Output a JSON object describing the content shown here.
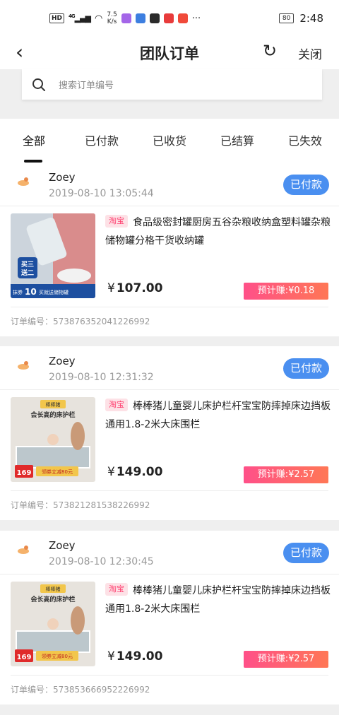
{
  "status_bar": {
    "network": "4G",
    "speed_value": "7.5",
    "speed_unit": "K/s",
    "battery": "80",
    "time": "2:48"
  },
  "nav": {
    "title": "团队订单",
    "close_label": "关闭"
  },
  "search": {
    "placeholder": "搜索订单编号"
  },
  "tabs": [
    {
      "label": "全部"
    },
    {
      "label": "已付款"
    },
    {
      "label": "已收货"
    },
    {
      "label": "已结算"
    },
    {
      "label": "已失效"
    }
  ],
  "orders": [
    {
      "user": "Zoey",
      "time": "2019-08-10 13:05:44",
      "status": "已付款",
      "platform": "淘宝",
      "title": "食品级密封罐厨房五谷杂粮收纳盒塑料罐杂粮储物罐分格干货收纳罐",
      "price": "107.00",
      "estimate": "预计赚:¥0.18",
      "order_no": "订单编号：573876352041226992",
      "thumb": {
        "badge_line1": "买三",
        "badge_line2": "送二",
        "promo": "10",
        "promo_prefix": "抹券",
        "promo_suffix": "买就送储物罐"
      }
    },
    {
      "user": "Zoey",
      "time": "2019-08-10 12:31:32",
      "status": "已付款",
      "platform": "淘宝",
      "title": "棒棒猪儿童婴儿床护栏杆宝宝防摔掉床边挡板通用1.8-2米大床围栏",
      "price": "149.00",
      "estimate": "预计赚:¥2.57",
      "order_no": "订单编号：573821281538226992",
      "thumb": {
        "brand": "棒棒猪",
        "headline": "会长高的床护栏",
        "price_tag": "169",
        "coupon": "领券立减80元"
      }
    },
    {
      "user": "Zoey",
      "time": "2019-08-10 12:30:45",
      "status": "已付款",
      "platform": "淘宝",
      "title": "棒棒猪儿童婴儿床护栏杆宝宝防摔掉床边挡板通用1.8-2米大床围栏",
      "price": "149.00",
      "estimate": "预计赚:¥2.57",
      "order_no": "订单编号：573853666952226992",
      "thumb": {
        "brand": "棒棒猪",
        "headline": "会长高的床护栏",
        "price_tag": "169",
        "coupon": "领券立减80元"
      }
    }
  ],
  "colors": {
    "accent_blue": "#4a8ff0",
    "estimate_pink": "#ff5089",
    "taobao_tag": "#ff3d6e"
  }
}
